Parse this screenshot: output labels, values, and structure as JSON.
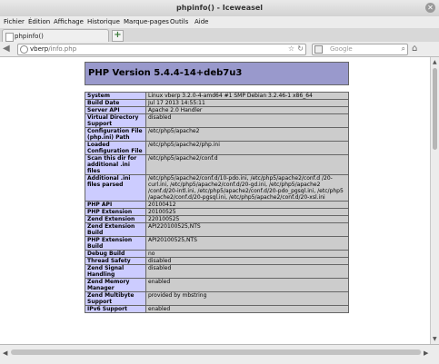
{
  "window": {
    "title": "phpinfo() - Iceweasel"
  },
  "menu": [
    "Fichier",
    "Édition",
    "Affichage",
    "Historique",
    "Marque-pages",
    "Outils",
    "Aide"
  ],
  "tabs": [
    {
      "label": "phpinfo()"
    }
  ],
  "navbar": {
    "url_host": "vberp",
    "url_path": "/info.php",
    "search_placeholder": "Google"
  },
  "page": {
    "heading": "PHP Version 5.4.4-14+deb7u3",
    "rows": [
      {
        "key": "System",
        "value": "Linux vberp 3.2.0-4-amd64 #1 SMP Debian 3.2.46-1 x86_64"
      },
      {
        "key": "Build Date",
        "value": "Jul 17 2013 14:55:11"
      },
      {
        "key": "Server API",
        "value": "Apache 2.0 Handler"
      },
      {
        "key": "Virtual Directory Support",
        "value": "disabled"
      },
      {
        "key": "Configuration File (php.ini) Path",
        "value": "/etc/php5/apache2"
      },
      {
        "key": "Loaded Configuration File",
        "value": "/etc/php5/apache2/php.ini"
      },
      {
        "key": "Scan this dir for additional .ini files",
        "value": "/etc/php5/apache2/conf.d"
      },
      {
        "key": "Additional .ini files parsed",
        "value": "/etc/php5/apache2/conf.d/10-pdo.ini, /etc/php5/apache2/conf.d /20-curl.ini, /etc/php5/apache2/conf.d/20-gd.ini, /etc/php5/apache2 /conf.d/20-intl.ini, /etc/php5/apache2/conf.d/20-pdo_pgsql.ini, /etc/php5 /apache2/conf.d/20-pgsql.ini, /etc/php5/apache2/conf.d/20-xsl.ini"
      },
      {
        "key": "PHP API",
        "value": "20100412"
      },
      {
        "key": "PHP Extension",
        "value": "20100525"
      },
      {
        "key": "Zend Extension",
        "value": "220100525"
      },
      {
        "key": "Zend Extension Build",
        "value": "API220100525,NTS"
      },
      {
        "key": "PHP Extension Build",
        "value": "API20100525,NTS"
      },
      {
        "key": "Debug Build",
        "value": "no"
      },
      {
        "key": "Thread Safety",
        "value": "disabled"
      },
      {
        "key": "Zend Signal Handling",
        "value": "disabled"
      },
      {
        "key": "Zend Memory Manager",
        "value": "enabled"
      },
      {
        "key": "Zend Multibyte Support",
        "value": "provided by mbstring"
      },
      {
        "key": "IPv6 Support",
        "value": "enabled"
      }
    ]
  },
  "colors": {
    "header_bg": "#9999cc",
    "key_bg": "#ccccff",
    "value_bg": "#cccccc"
  }
}
